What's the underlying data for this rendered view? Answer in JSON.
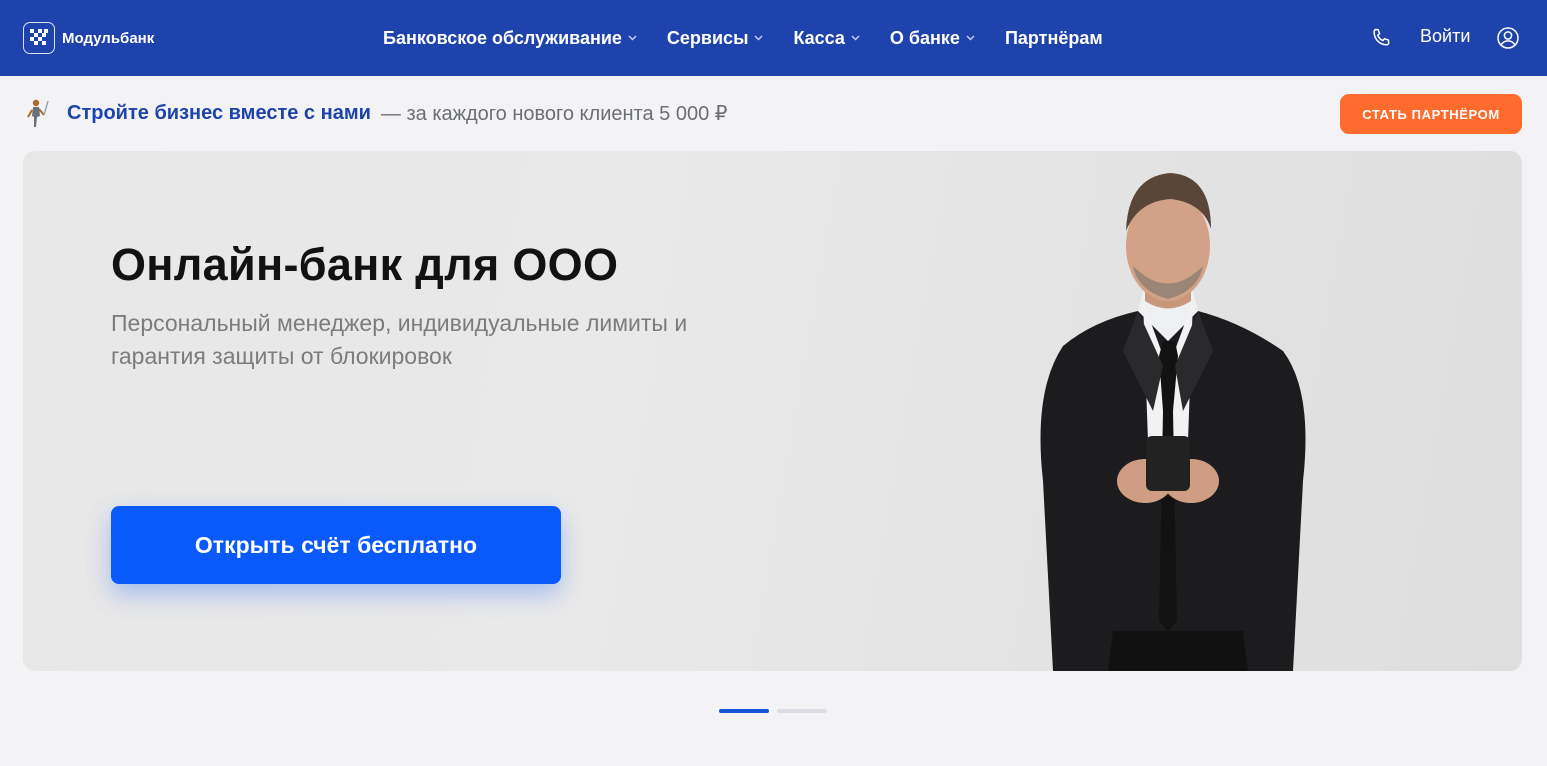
{
  "header": {
    "logo_text": "Модульбанк",
    "nav": [
      {
        "label": "Банковское обслуживание",
        "has_dropdown": true
      },
      {
        "label": "Сервисы",
        "has_dropdown": true
      },
      {
        "label": "Касса",
        "has_dropdown": true
      },
      {
        "label": "О банке",
        "has_dropdown": true
      },
      {
        "label": "Партнёрам",
        "has_dropdown": false
      }
    ],
    "login_label": "Войти",
    "icons": [
      "phone-icon",
      "user-icon",
      "chevron-down-icon"
    ],
    "bg_color": "#1f43ad"
  },
  "promo": {
    "bold_text": "Стройте бизнес вместе с нами",
    "rest_text": "— за каждого нового клиента 5 000 ₽",
    "cta_label": "СТАТЬ ПАРТНЁРОМ",
    "cta_color": "#ff6b2c",
    "icon": "golfer-icon"
  },
  "hero": {
    "title": "Онлайн-банк для ООО",
    "subtitle": "Персональный менеджер, индивидуальные лимиты и гарантия защиты от блокировок",
    "cta_label": "Открыть счёт бесплатно",
    "cta_color": "#0a59fb",
    "image": "businessman-with-phone"
  },
  "slider": {
    "total": 2,
    "active": 1
  }
}
